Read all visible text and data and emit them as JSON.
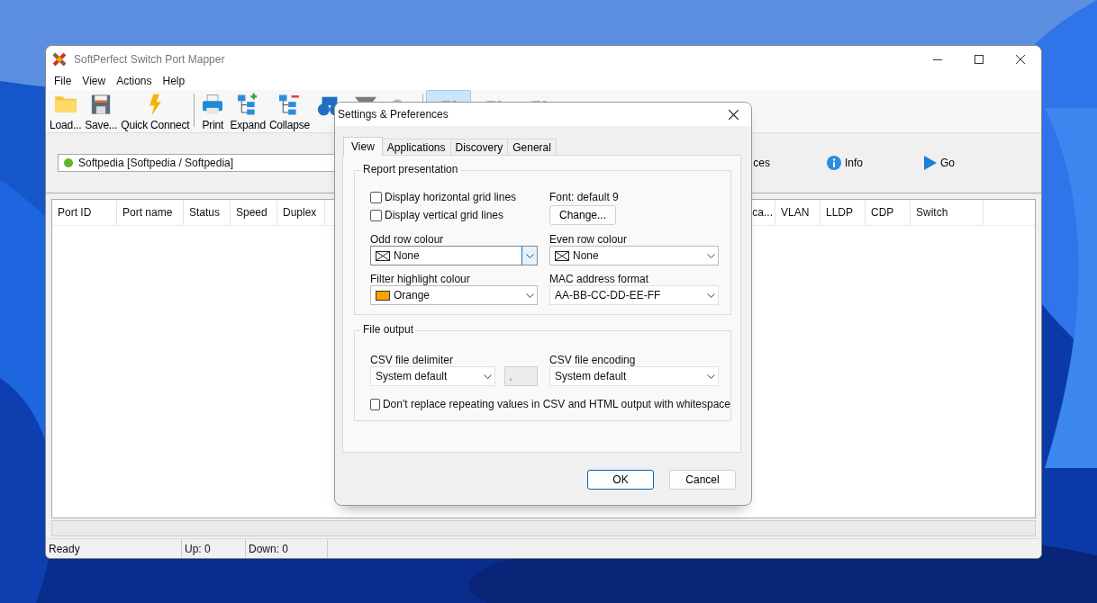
{
  "window": {
    "title": "SoftPerfect Switch Port Mapper"
  },
  "menu": [
    "File",
    "View",
    "Actions",
    "Help"
  ],
  "toolbar": [
    {
      "kind": "folder",
      "label": "Load..."
    },
    {
      "kind": "floppy",
      "label": "Save..."
    },
    {
      "kind": "bolt",
      "label": "Quick Connect"
    },
    {
      "kind": "separator"
    },
    {
      "kind": "printer",
      "label": "Print"
    },
    {
      "kind": "expand",
      "label": "Expand"
    },
    {
      "kind": "collapse",
      "label": "Collapse"
    },
    {
      "kind": "binoculars"
    },
    {
      "kind": "filter"
    },
    {
      "kind": "gears"
    },
    {
      "kind": "separator"
    },
    {
      "kind": "view",
      "pressed": true
    },
    {
      "kind": "view",
      "pressed": false
    },
    {
      "kind": "view",
      "pressed": false
    }
  ],
  "connection": {
    "label": "Softpedia [Softpedia / Softpedia]",
    "online": true
  },
  "actions": [
    {
      "kind": "text",
      "label": "ces"
    },
    {
      "kind": "info",
      "label": "Info"
    },
    {
      "kind": "go",
      "label": "Go"
    }
  ],
  "table": {
    "columns_left": [
      "Port ID",
      "Port name",
      "Status",
      "Speed",
      "Duplex"
    ],
    "columns_right": [
      "ca...",
      "VLAN",
      "LLDP",
      "CDP",
      "Switch"
    ]
  },
  "status_bar": [
    "Ready",
    "Up: 0",
    "Down: 0"
  ],
  "dialog": {
    "title": "Settings & Preferences",
    "tabs": [
      {
        "label": "View",
        "selected": true
      },
      {
        "label": "Applications",
        "selected": false
      },
      {
        "label": "Discovery",
        "selected": false
      },
      {
        "label": "General",
        "selected": false
      }
    ],
    "report": {
      "title": "Report presentation",
      "checkboxes": [
        {
          "label": "Display horizontal grid lines",
          "checked": false
        },
        {
          "label": "Display vertical grid lines",
          "checked": false
        }
      ],
      "font_label": "Font: default 9",
      "change_button": "Change...",
      "fields": [
        {
          "label": "Odd row colour",
          "value": "None",
          "kind": "swatch",
          "focused": true
        },
        {
          "label": "Even row colour",
          "value": "None",
          "kind": "swatch",
          "focused": false
        },
        {
          "label": "Filter highlight colour",
          "value": "Orange",
          "kind": "swatch",
          "color": "#ffa200",
          "focused": false
        },
        {
          "label": "MAC address format",
          "value": "AA-BB-CC-DD-EE-FF",
          "kind": "plain",
          "focused": false
        }
      ]
    },
    "file_output": {
      "title": "File output",
      "delimiter": {
        "label": "CSV file delimiter",
        "value": "System default",
        "custom": ","
      },
      "encoding": {
        "label": "CSV file encoding",
        "value": "System default"
      },
      "checkbox": {
        "label": "Don't replace repeating values in CSV and HTML output with whitespace",
        "checked": false
      }
    },
    "buttons": [
      {
        "label": "OK",
        "default": true
      },
      {
        "label": "Cancel",
        "default": false
      }
    ]
  }
}
